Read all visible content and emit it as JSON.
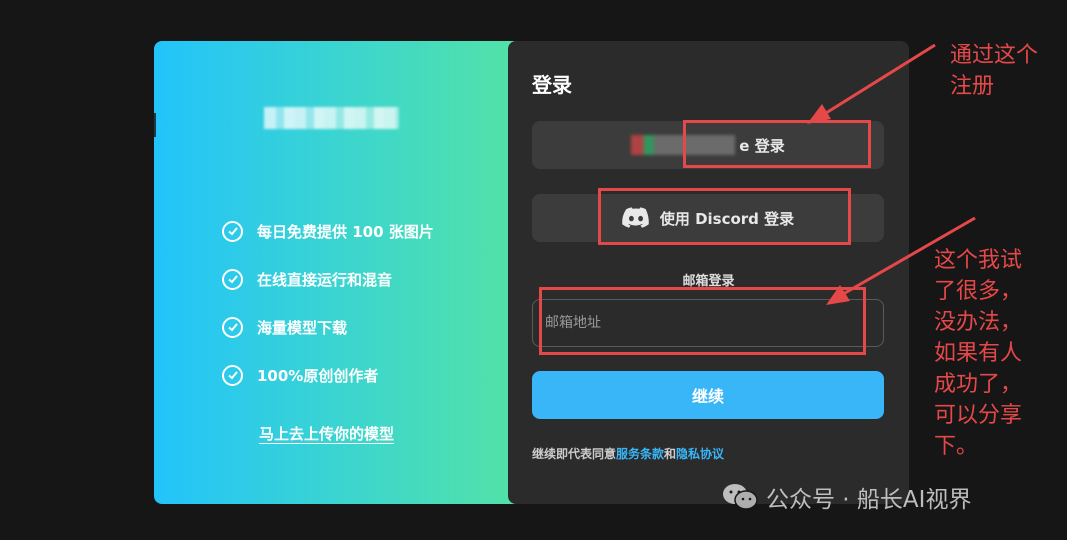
{
  "left_panel": {
    "features": [
      "每日免费提供 100 张图片",
      "在线直接运行和混音",
      "海量模型下载",
      "100%原创创作者"
    ],
    "upload_link": "马上去上传你的模型"
  },
  "login": {
    "title": "登录",
    "google_button_suffix": "e 登录",
    "discord_button": "使用 Discord 登录",
    "email_section_label": "邮箱登录",
    "email_placeholder": "邮箱地址",
    "continue_button": "继续",
    "terms_prefix": "继续即代表同意",
    "terms_link": "服务条款",
    "terms_and": "和",
    "privacy_link": "隐私协议"
  },
  "annotations": {
    "top_note": [
      "通过这个",
      "注册"
    ],
    "side_note": [
      "这个我试",
      "了很多，",
      "没办法，",
      "如果有人",
      "成功了，",
      "可以分享",
      "下。"
    ]
  },
  "watermark": {
    "text": "公众号 · 船长AI视界"
  },
  "colors": {
    "accent_blue": "#38b6f8",
    "annotation_red": "#e54848",
    "panel_dark": "#2b2b2b"
  }
}
